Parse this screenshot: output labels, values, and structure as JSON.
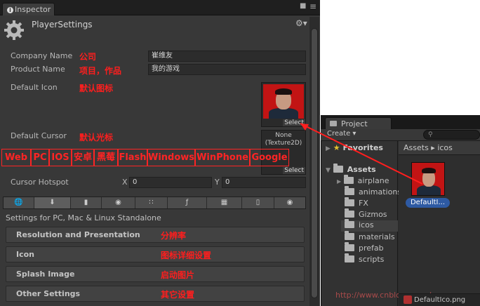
{
  "inspector": {
    "tab_label": "Inspector",
    "title": "PlayerSettings",
    "fields": [
      {
        "label": "Company Name",
        "note": "公司",
        "value": "崔维友"
      },
      {
        "label": "Product Name",
        "note": "项目，作品",
        "value": "我的游戏"
      }
    ],
    "default_icon": {
      "label": "Default Icon",
      "note": "默认图标",
      "select": "Select"
    },
    "default_cursor": {
      "label": "Default Cursor",
      "note": "默认光标",
      "preview": "None\n(Texture2D)",
      "select": "Select"
    },
    "platform_annotations": [
      "Web",
      "PC",
      "IOS",
      "安卓",
      "黑莓",
      "Flash",
      "Windows",
      "WinPhone",
      "Google"
    ],
    "cursor_hotspot": {
      "label": "Cursor Hotspot",
      "x_label": "X",
      "x_value": "0",
      "y_label": "Y",
      "y_value": "0"
    },
    "platform_tabs": [
      "web-globe-icon",
      "standalone-download-icon",
      "ios-phone-icon",
      "android-icon",
      "blackberry-icon",
      "flash-icon",
      "windows-icon",
      "winphone-icon",
      "google-icon"
    ],
    "settings_for": "Settings for PC, Mac & Linux Standalone",
    "sections": [
      {
        "title": "Resolution and Presentation",
        "note": "分辨率"
      },
      {
        "title": "Icon",
        "note": "图标详细设置"
      },
      {
        "title": "Splash Image",
        "note": "启动图片"
      },
      {
        "title": "Other Settings",
        "note": "其它设置"
      }
    ]
  },
  "project": {
    "tab_label": "Project",
    "create_label": "Create ▾",
    "favorites": "Favorites",
    "assets": "Assets",
    "folders": [
      "airplane",
      "animations",
      "FX",
      "Gizmos",
      "icos",
      "materials",
      "prefab",
      "scripts"
    ],
    "selected_folder": "icos",
    "breadcrumb": "Assets ▸ icos",
    "asset_label": "DefaultI...",
    "status_file": "DefaultIco.png",
    "watermark": "http://www.cnblogs.com/"
  },
  "colors": {
    "annotation_red": "#ff1e1e",
    "selection_blue": "#2e5aa3"
  }
}
